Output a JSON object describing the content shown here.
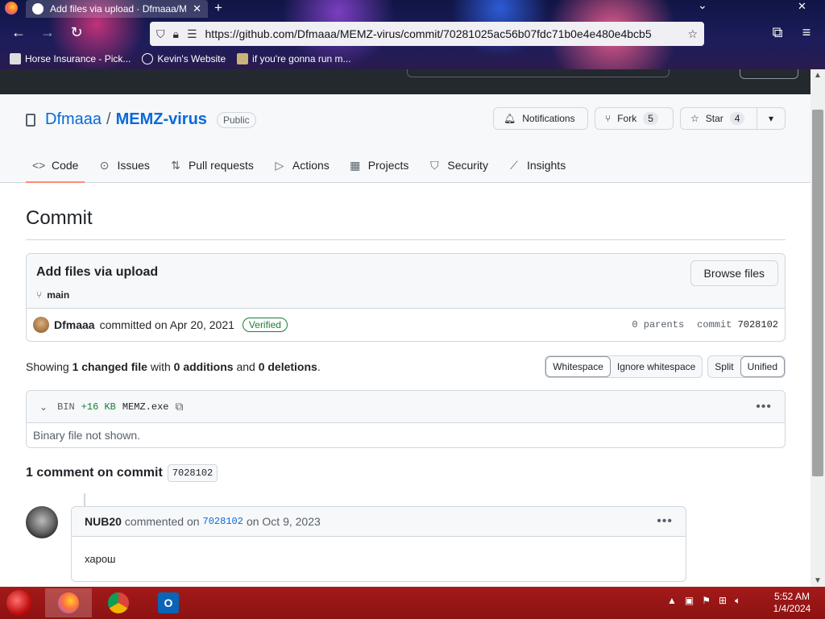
{
  "browser": {
    "tab_title": "Add files via upload · Dfmaaa/MEMZ-virus",
    "url": "https://github.com/Dfmaaa/MEMZ-virus/commit/70281025ac56b07fdc71b0e4e480e4bcb5",
    "bookmarks": [
      {
        "label": "Horse Insurance - Pick..."
      },
      {
        "label": "Kevin's Website"
      },
      {
        "label": "if you're gonna run m..."
      }
    ]
  },
  "repo": {
    "owner": "Dfmaaa",
    "name": "MEMZ-virus",
    "visibility": "Public",
    "notifications_label": "Notifications",
    "fork_label": "Fork",
    "fork_count": "5",
    "star_label": "Star",
    "star_count": "4",
    "tabs": [
      {
        "label": "Code"
      },
      {
        "label": "Issues"
      },
      {
        "label": "Pull requests"
      },
      {
        "label": "Actions"
      },
      {
        "label": "Projects"
      },
      {
        "label": "Security"
      },
      {
        "label": "Insights"
      }
    ]
  },
  "commit": {
    "heading": "Commit",
    "message": "Add files via upload",
    "branch": "main",
    "browse_label": "Browse files",
    "author": "Dfmaaa",
    "committed_text": "committed on Apr 20, 2021",
    "verified": "Verified",
    "parents_text": "0 parents",
    "commit_label": "commit",
    "sha_short": "7028102"
  },
  "summary": {
    "showing": "Showing",
    "changed": "1 changed file",
    "with": "with",
    "additions": "0 additions",
    "and": "and",
    "deletions": "0 deletions",
    "period": ".",
    "whitespace": "Whitespace",
    "ignore_whitespace": "Ignore whitespace",
    "split": "Split",
    "unified": "Unified"
  },
  "file": {
    "type": "BIN",
    "size_change": "+16 KB",
    "name": "MEMZ.exe",
    "body": "Binary file not shown."
  },
  "comments": {
    "heading": "1 comment on commit",
    "sha": "7028102",
    "items": [
      {
        "author": "NUB20",
        "commented_on": "commented on",
        "sha": "7028102",
        "date": "on Oct 9, 2023",
        "body": "харош"
      }
    ]
  },
  "taskbar": {
    "time": "5:52 AM",
    "date": "1/4/2024"
  },
  "colors": {
    "accent_link": "#0969da",
    "tab_underline": "#fd8c73",
    "verified_green": "#1a7f37",
    "taskbar_red": "#a31a1a"
  }
}
